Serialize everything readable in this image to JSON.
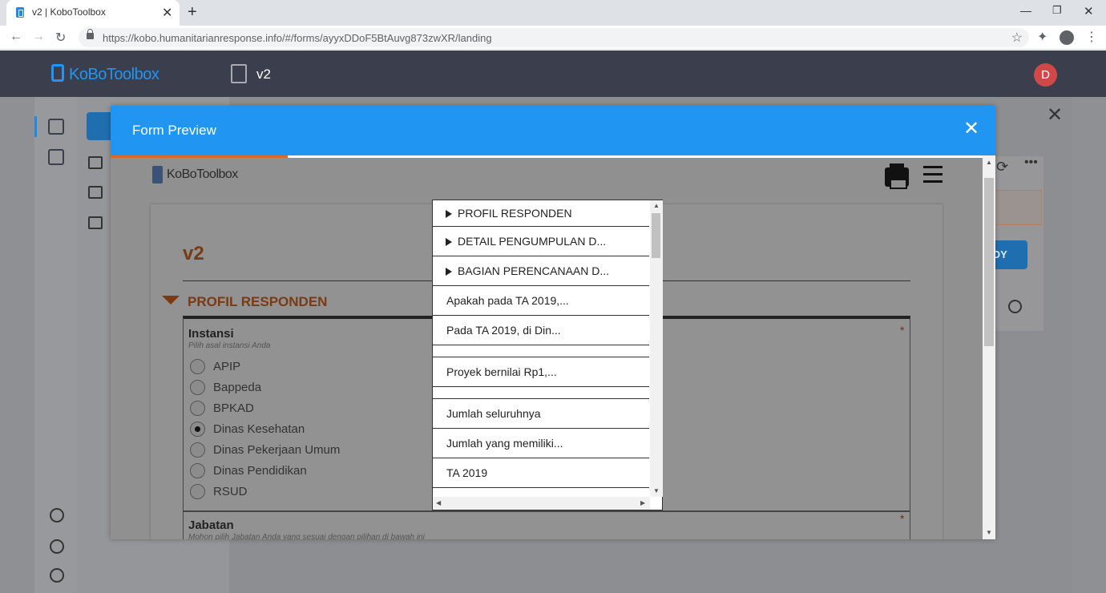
{
  "browser": {
    "tab_title": "v2 | KoboToolbox",
    "url": "https://kobo.humanitarianresponse.info/#/forms/ayyxDDoF5BtAuvg873zwXR/landing",
    "icons": [
      "close-icon",
      "plus-icon",
      "back-icon",
      "forward-icon",
      "reload-icon",
      "lock-icon",
      "star-icon",
      "extensions-icon",
      "account-icon",
      "more-vert-icon"
    ]
  },
  "app": {
    "logo_text": "KoBoToolbox",
    "form_name": "v2",
    "avatar_letter": "D",
    "deploy_fragment": "OY"
  },
  "modal": {
    "title": "Form Preview",
    "close_glyph": "✕"
  },
  "preview": {
    "logo_text": "KoBoToolbox",
    "form_title": "v2",
    "group_name": "PROFIL RESPONDEN",
    "q1": {
      "label": "Instansi",
      "hint": "Pilih asal instansi Anda",
      "required": "*",
      "options": [
        {
          "label": "APIP",
          "selected": false
        },
        {
          "label": "Bappeda",
          "selected": false
        },
        {
          "label": "BPKAD",
          "selected": false
        },
        {
          "label": "Dinas Kesehatan",
          "selected": true
        },
        {
          "label": "Dinas Pekerjaan Umum",
          "selected": false
        },
        {
          "label": "Dinas Pendidikan",
          "selected": false
        },
        {
          "label": "RSUD",
          "selected": false
        }
      ]
    },
    "q2": {
      "label": "Jabatan",
      "hint": "Mohon pilih Jabatan Anda yang sesuai dengan pilihan di bawah ini",
      "required": "*"
    },
    "toc": [
      {
        "label": "PROFIL RESPONDEN",
        "group": true
      },
      {
        "label": "DETAIL PENGUMPULAN D...",
        "group": true
      },
      {
        "label": "BAGIAN PERENCANAAN D...",
        "group": true
      },
      {
        "label": "Apakah pada TA 2019,...",
        "group": false
      },
      {
        "label": "Pada TA 2019, di Din...",
        "group": false
      },
      {
        "label": "",
        "group": false
      },
      {
        "label": "Proyek bernilai Rp1,...",
        "group": false
      },
      {
        "label": "",
        "group": false
      },
      {
        "label": "Jumlah seluruhnya",
        "group": false
      },
      {
        "label": "Jumlah yang memiliki...",
        "group": false
      },
      {
        "label": "TA 2019",
        "group": false
      }
    ]
  },
  "colors": {
    "header_bg": "#3a3e4d",
    "brand_blue": "#2095f2",
    "accent_orange": "#d86a2d",
    "avatar_red": "#d14848"
  }
}
